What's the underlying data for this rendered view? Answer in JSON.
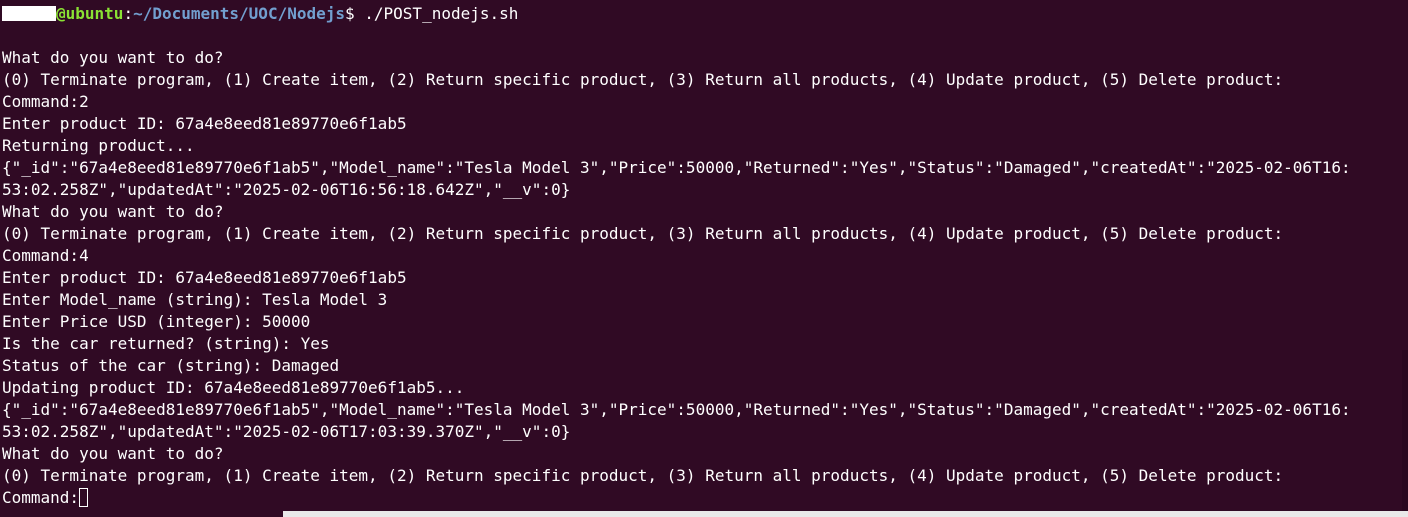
{
  "prompt": {
    "host": "@ubuntu",
    "separator": ":",
    "path": "~/Documents/UOC/Nodejs",
    "symbol": "$ ",
    "command": "./POST_nodejs.sh"
  },
  "output_lines": [
    "",
    "What do you want to do?",
    "(0) Terminate program, (1) Create item, (2) Return specific product, (3) Return all products, (4) Update product, (5) Delete product:",
    "Command:2",
    "Enter product ID: 67a4e8eed81e89770e6f1ab5",
    "Returning product...",
    "{\"_id\":\"67a4e8eed81e89770e6f1ab5\",\"Model_name\":\"Tesla Model 3\",\"Price\":50000,\"Returned\":\"Yes\",\"Status\":\"Damaged\",\"createdAt\":\"2025-02-06T16:",
    "53:02.258Z\",\"updatedAt\":\"2025-02-06T16:56:18.642Z\",\"__v\":0}",
    "What do you want to do?",
    "(0) Terminate program, (1) Create item, (2) Return specific product, (3) Return all products, (4) Update product, (5) Delete product:",
    "Command:4",
    "Enter product ID: 67a4e8eed81e89770e6f1ab5",
    "Enter Model_name (string): Tesla Model 3",
    "Enter Price USD (integer): 50000",
    "Is the car returned? (string): Yes",
    "Status of the car (string): Damaged",
    "Updating product ID: 67a4e8eed81e89770e6f1ab5...",
    "{\"_id\":\"67a4e8eed81e89770e6f1ab5\",\"Model_name\":\"Tesla Model 3\",\"Price\":50000,\"Returned\":\"Yes\",\"Status\":\"Damaged\",\"createdAt\":\"2025-02-06T16:",
    "53:02.258Z\",\"updatedAt\":\"2025-02-06T17:03:39.370Z\",\"__v\":0}",
    "What do you want to do?",
    "(0) Terminate program, (1) Create item, (2) Return specific product, (3) Return all products, (4) Update product, (5) Delete product:"
  ],
  "input_line": {
    "label": "Command:"
  },
  "colors": {
    "background": "#300a24",
    "foreground": "#ffffff",
    "prompt_host": "#8ae234",
    "prompt_path": "#729fcf"
  }
}
